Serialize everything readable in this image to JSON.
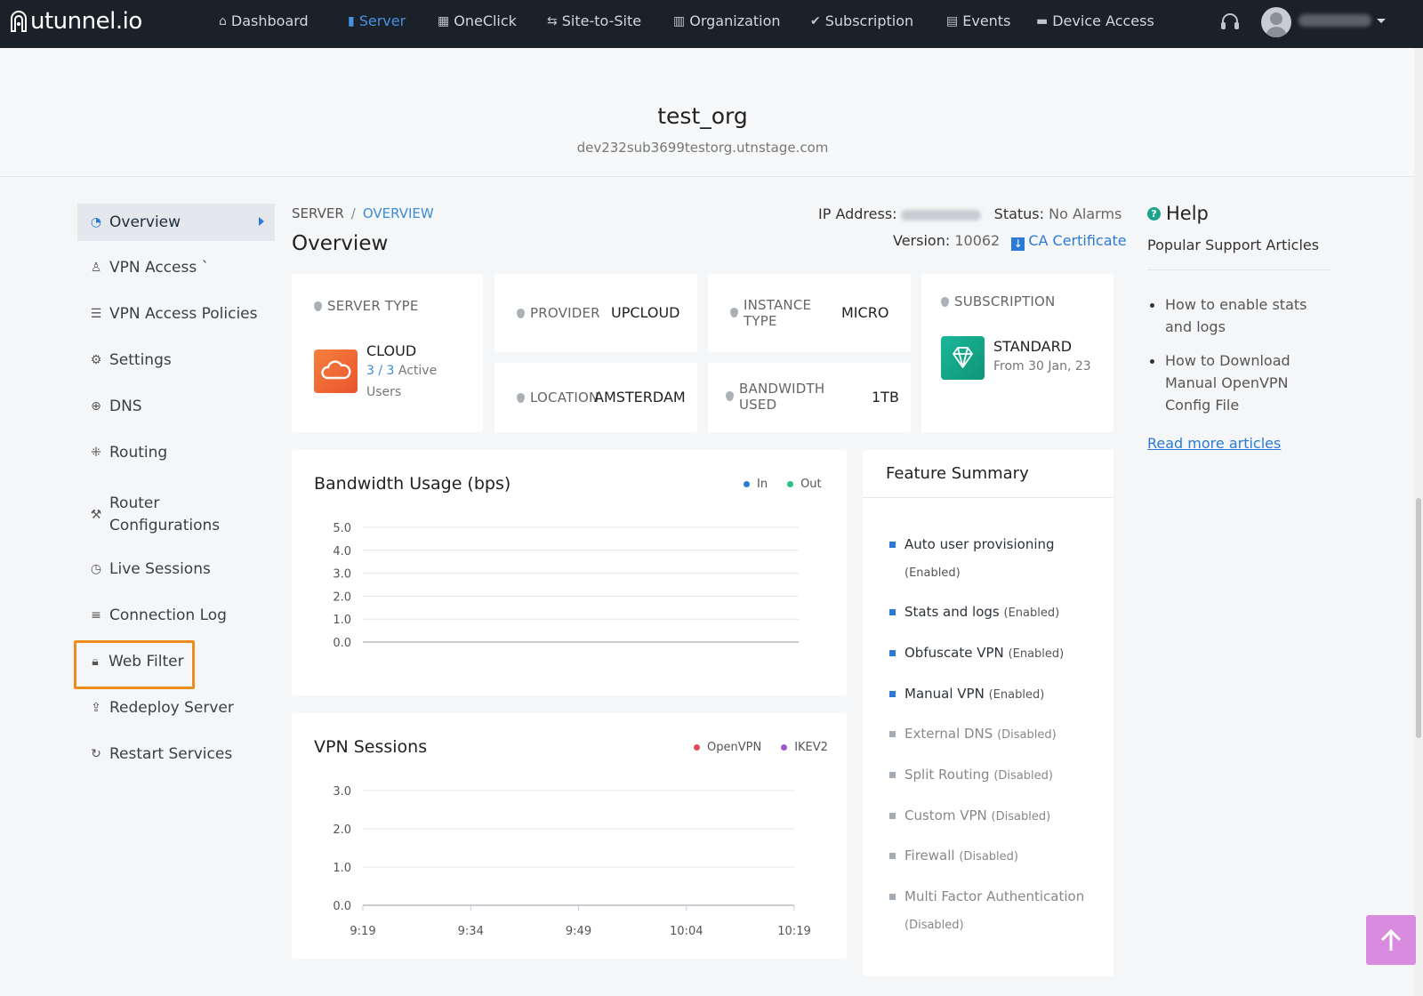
{
  "nav": {
    "logo": "utunnel.io",
    "items": [
      {
        "label": "Dashboard",
        "icon": "home-icon"
      },
      {
        "label": "Server",
        "icon": "server-icon",
        "active": true
      },
      {
        "label": "OneClick",
        "icon": "grid-icon"
      },
      {
        "label": "Site-to-Site",
        "icon": "link-arrows-icon"
      },
      {
        "label": "Organization",
        "icon": "building-icon"
      },
      {
        "label": "Subscription",
        "icon": "check-circle-icon"
      },
      {
        "label": "Events",
        "icon": "list-icon"
      },
      {
        "label": "Device Access",
        "icon": "monitor-icon"
      }
    ]
  },
  "org": {
    "name": "test_org",
    "domain": "dev232sub3699testorg.utnstage.com"
  },
  "sidebar": {
    "items": [
      {
        "label": "Overview",
        "icon": "pie-chart-icon"
      },
      {
        "label": "VPN Access `",
        "icon": "user-icon"
      },
      {
        "label": "VPN Access Policies",
        "icon": "list-icon"
      },
      {
        "label": "Settings",
        "icon": "gear-icon"
      },
      {
        "label": "DNS",
        "icon": "globe-icon"
      },
      {
        "label": "Routing",
        "icon": "routing-icon"
      },
      {
        "label": "Router Configurations",
        "icon": "wrench-icon"
      },
      {
        "label": "Live Sessions",
        "icon": "clock-icon"
      },
      {
        "label": "Connection Log",
        "icon": "lines-icon"
      },
      {
        "label": "Web Filter",
        "icon": "lock-icon"
      },
      {
        "label": "Redeploy Server",
        "icon": "redeploy-icon"
      },
      {
        "label": "Restart Services",
        "icon": "restart-icon"
      }
    ]
  },
  "breadcrumb": {
    "root": "SERVER",
    "sep": "/",
    "current": "OVERVIEW"
  },
  "page_title": "Overview",
  "server_info": {
    "ip_label": "IP Address:",
    "status_label": "Status:",
    "status_value": "No Alarms",
    "version_label": "Version:",
    "version_value": "10062",
    "ca_label": "CA Certificate"
  },
  "cards": {
    "server_type": {
      "label": "SERVER TYPE",
      "value": "CLOUD",
      "active": "3 / 3",
      "active_label": "Active",
      "users_label": "Users"
    },
    "provider": {
      "label": "PROVIDER",
      "value": "UPCLOUD"
    },
    "location": {
      "label": "LOCATION",
      "value": "AMSTERDAM"
    },
    "instance_type": {
      "label1": "INSTANCE",
      "label2": "TYPE",
      "value": "MICRO"
    },
    "bandwidth_used": {
      "label1": "BANDWIDTH",
      "label2": "USED",
      "value": "1TB"
    },
    "subscription": {
      "label": "SUBSCRIPTION",
      "plan": "STANDARD",
      "from": "From 30 Jan, 23"
    }
  },
  "chart_data": [
    {
      "type": "line",
      "title": "Bandwidth Usage (bps)",
      "legend": "top-right",
      "series": [
        {
          "name": "In",
          "color": "#2b7bd6",
          "values": []
        },
        {
          "name": "Out",
          "color": "#26c281",
          "values": []
        }
      ],
      "yticks": [
        "5.0",
        "4.0",
        "3.0",
        "2.0",
        "1.0",
        "0.0"
      ],
      "ylim": [
        0,
        5
      ],
      "grid": true
    },
    {
      "type": "line",
      "title": "VPN Sessions",
      "legend": "top-right",
      "series": [
        {
          "name": "OpenVPN",
          "color": "#e04b5f",
          "values": []
        },
        {
          "name": "IKEV2",
          "color": "#9b59d0",
          "values": []
        }
      ],
      "yticks": [
        "3.0",
        "2.0",
        "1.0",
        "0.0"
      ],
      "xticks": [
        "9:19",
        "9:34",
        "9:49",
        "10:04",
        "10:19"
      ],
      "ylim": [
        0,
        3
      ],
      "grid": true
    }
  ],
  "features": {
    "title": "Feature Summary",
    "items": [
      {
        "name": "Auto user provisioning",
        "status": "(Enabled)"
      },
      {
        "name": "Stats and logs",
        "status": "(Enabled)"
      },
      {
        "name": "Obfuscate VPN",
        "status": "(Enabled)"
      },
      {
        "name": "Manual VPN",
        "status": "(Enabled)"
      },
      {
        "name": "External DNS",
        "status": "(Disabled)"
      },
      {
        "name": "Split Routing",
        "status": "(Disabled)"
      },
      {
        "name": "Custom VPN",
        "status": "(Disabled)"
      },
      {
        "name": "Firewall",
        "status": "(Disabled)"
      },
      {
        "name": "Multi Factor Authentication",
        "status": "(Disabled)"
      }
    ]
  },
  "help": {
    "title": "Help",
    "subtitle": "Popular Support Articles",
    "articles": [
      "How to enable stats and logs",
      "How to Download Manual OpenVPN Config File"
    ],
    "read_more": "Read more articles"
  }
}
